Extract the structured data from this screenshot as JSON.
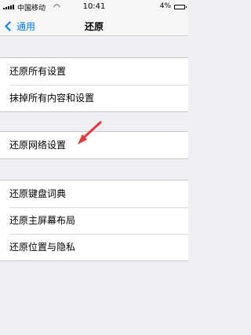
{
  "status_bar": {
    "carrier": "中国移动",
    "time": "10:41",
    "battery": "4%"
  },
  "nav": {
    "back_label": "通用",
    "title": "还原"
  },
  "groups": [
    {
      "items": [
        "还原所有设置",
        "抹掉所有内容和设置"
      ]
    },
    {
      "items": [
        "还原网络设置"
      ]
    },
    {
      "items": [
        "还原键盘词典",
        "还原主屏幕布局",
        "还原位置与隐私"
      ]
    }
  ],
  "colors": {
    "accent": "#007aff",
    "arrow": "#e23a3a",
    "background": "#efeff4"
  }
}
